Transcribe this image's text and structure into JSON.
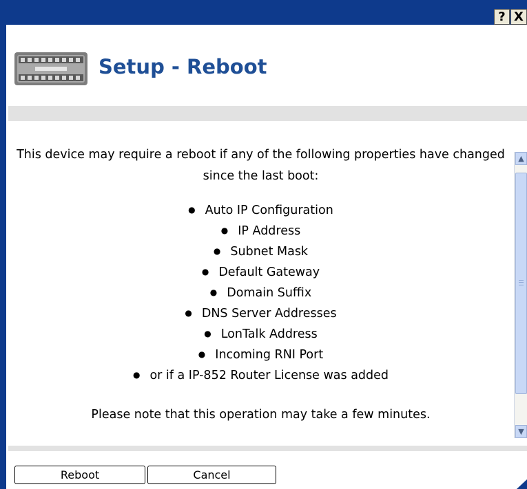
{
  "window": {
    "help_label": "?",
    "close_label": "X"
  },
  "header": {
    "title": "Setup - Reboot",
    "device_image": "device-module-image"
  },
  "content": {
    "intro": "This device may require a reboot if any of the following properties have changed since the last boot:",
    "items": [
      "Auto IP Configuration",
      "IP Address",
      "Subnet Mask",
      "Default Gateway",
      "Domain Suffix",
      "DNS Server Addresses",
      "LonTalk Address",
      "Incoming RNI Port",
      "or if a IP-852 Router License was added"
    ],
    "note": "Please note that this operation may take a few minutes."
  },
  "scrollbar": {
    "up_icon": "arrow-up-icon",
    "down_icon": "arrow-down-icon"
  },
  "buttons": {
    "reboot": "Reboot",
    "cancel": "Cancel"
  },
  "colors": {
    "titlebar": "#0e3a8c",
    "title_text": "#1f4f96",
    "band": "#e2e2e2"
  }
}
